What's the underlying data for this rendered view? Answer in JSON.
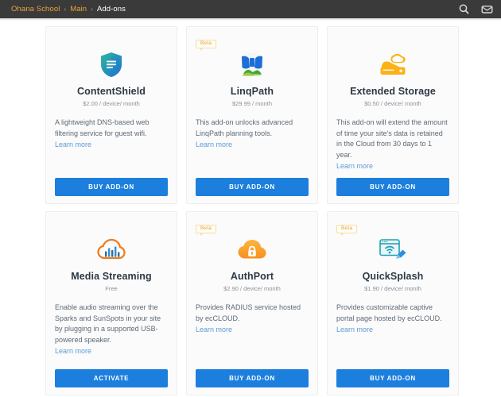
{
  "topbar": {
    "breadcrumb": {
      "root": "Ohana School",
      "sep1": "›",
      "middle": "Main",
      "sep2": "›",
      "current": "Add-ons"
    },
    "icons": [
      {
        "name": "search-icon",
        "label": "Search"
      },
      {
        "name": "mail-icon",
        "label": "Messages"
      }
    ]
  },
  "addons": [
    {
      "id": "contentshield",
      "badge": null,
      "icon": "shield-icon",
      "title": "ContentShield",
      "price": "$2.00 / device/ month",
      "description": "A lightweight DNS-based web filtering service for guest wifi.",
      "learn_more": "Learn more",
      "button": "BUY ADD-ON"
    },
    {
      "id": "linqpath",
      "badge": "Beta",
      "icon": "binoculars-icon",
      "title": "LinqPath",
      "price": "$29.99 / month",
      "description": "This add-on unlocks advanced LinqPath planning tools.",
      "learn_more": "Learn more",
      "button": "BUY ADD-ON"
    },
    {
      "id": "extended-storage",
      "badge": null,
      "icon": "cloud-drive-icon",
      "title": "Extended Storage",
      "price": "$0.50 / device/ month",
      "description": "This add-on will extend the amount of time your site's data is retained in the Cloud from 30 days to 1 year.",
      "learn_more": "Learn more",
      "button": "BUY ADD-ON"
    },
    {
      "id": "media-streaming",
      "badge": null,
      "icon": "cloud-equalizer-icon",
      "title": "Media Streaming",
      "price": "Free",
      "description": "Enable audio streaming over the Sparks and SunSpots in your site by plugging in a supported USB-powered speaker.",
      "learn_more": "Learn more",
      "button": "ACTIVATE"
    },
    {
      "id": "authport",
      "badge": "Beta",
      "icon": "cloud-lock-icon",
      "title": "AuthPort",
      "price": "$2.90 / device/ month",
      "description": "Provides RADIUS service hosted by ecCLOUD.",
      "learn_more": "Learn more",
      "button": "BUY ADD-ON"
    },
    {
      "id": "quicksplash",
      "badge": "Beta",
      "icon": "captive-portal-icon",
      "title": "QuickSplash",
      "price": "$1.90 / device/ month",
      "description": "Provides customizable captive portal page hosted by ecCLOUD.",
      "learn_more": "Learn more",
      "button": "BUY ADD-ON"
    }
  ],
  "colors": {
    "topbar_bg": "#3a3a3a",
    "breadcrumb_link": "#e8a33d",
    "button_blue": "#1d7fdd",
    "link_blue": "#5b9bd5",
    "badge_border": "#f5dea1",
    "badge_text": "#e0a33a"
  }
}
